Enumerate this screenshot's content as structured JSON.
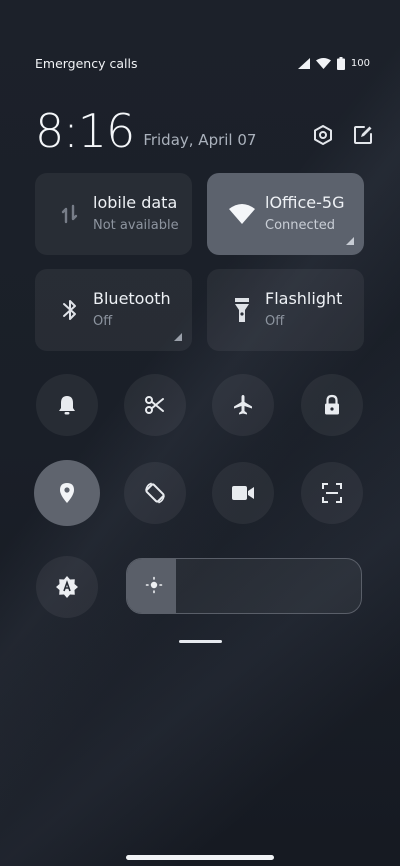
{
  "status_bar": {
    "left_text": "Emergency calls o",
    "battery_percent": "100"
  },
  "header": {
    "time": "8:16",
    "date": "Friday, April 07"
  },
  "tiles": {
    "mobile_data": {
      "title": "lobile data",
      "subtitle": "Not available",
      "active": false
    },
    "wifi": {
      "title": "lOffice-5G",
      "subtitle": "Connected",
      "active": true
    },
    "bluetooth": {
      "title": "Bluetooth",
      "subtitle": "Off",
      "active": false
    },
    "flashlight": {
      "title": "Flashlight",
      "subtitle": "Off",
      "active": false
    }
  },
  "toggles_row1": [
    "bell-icon",
    "scissors-icon",
    "airplane-icon",
    "lock-icon"
  ],
  "toggles_row2": [
    "location-icon",
    "auto-rotate-icon",
    "video-camera-icon",
    "scan-icon"
  ],
  "active_toggle": "location-icon",
  "brightness": {
    "level_fraction": 0.21
  },
  "colors": {
    "background": "#1b2029",
    "tile_inactive": "#252a33",
    "tile_active": "#5c626d",
    "text_primary": "#eef1f5",
    "text_secondary": "#8d949f"
  }
}
